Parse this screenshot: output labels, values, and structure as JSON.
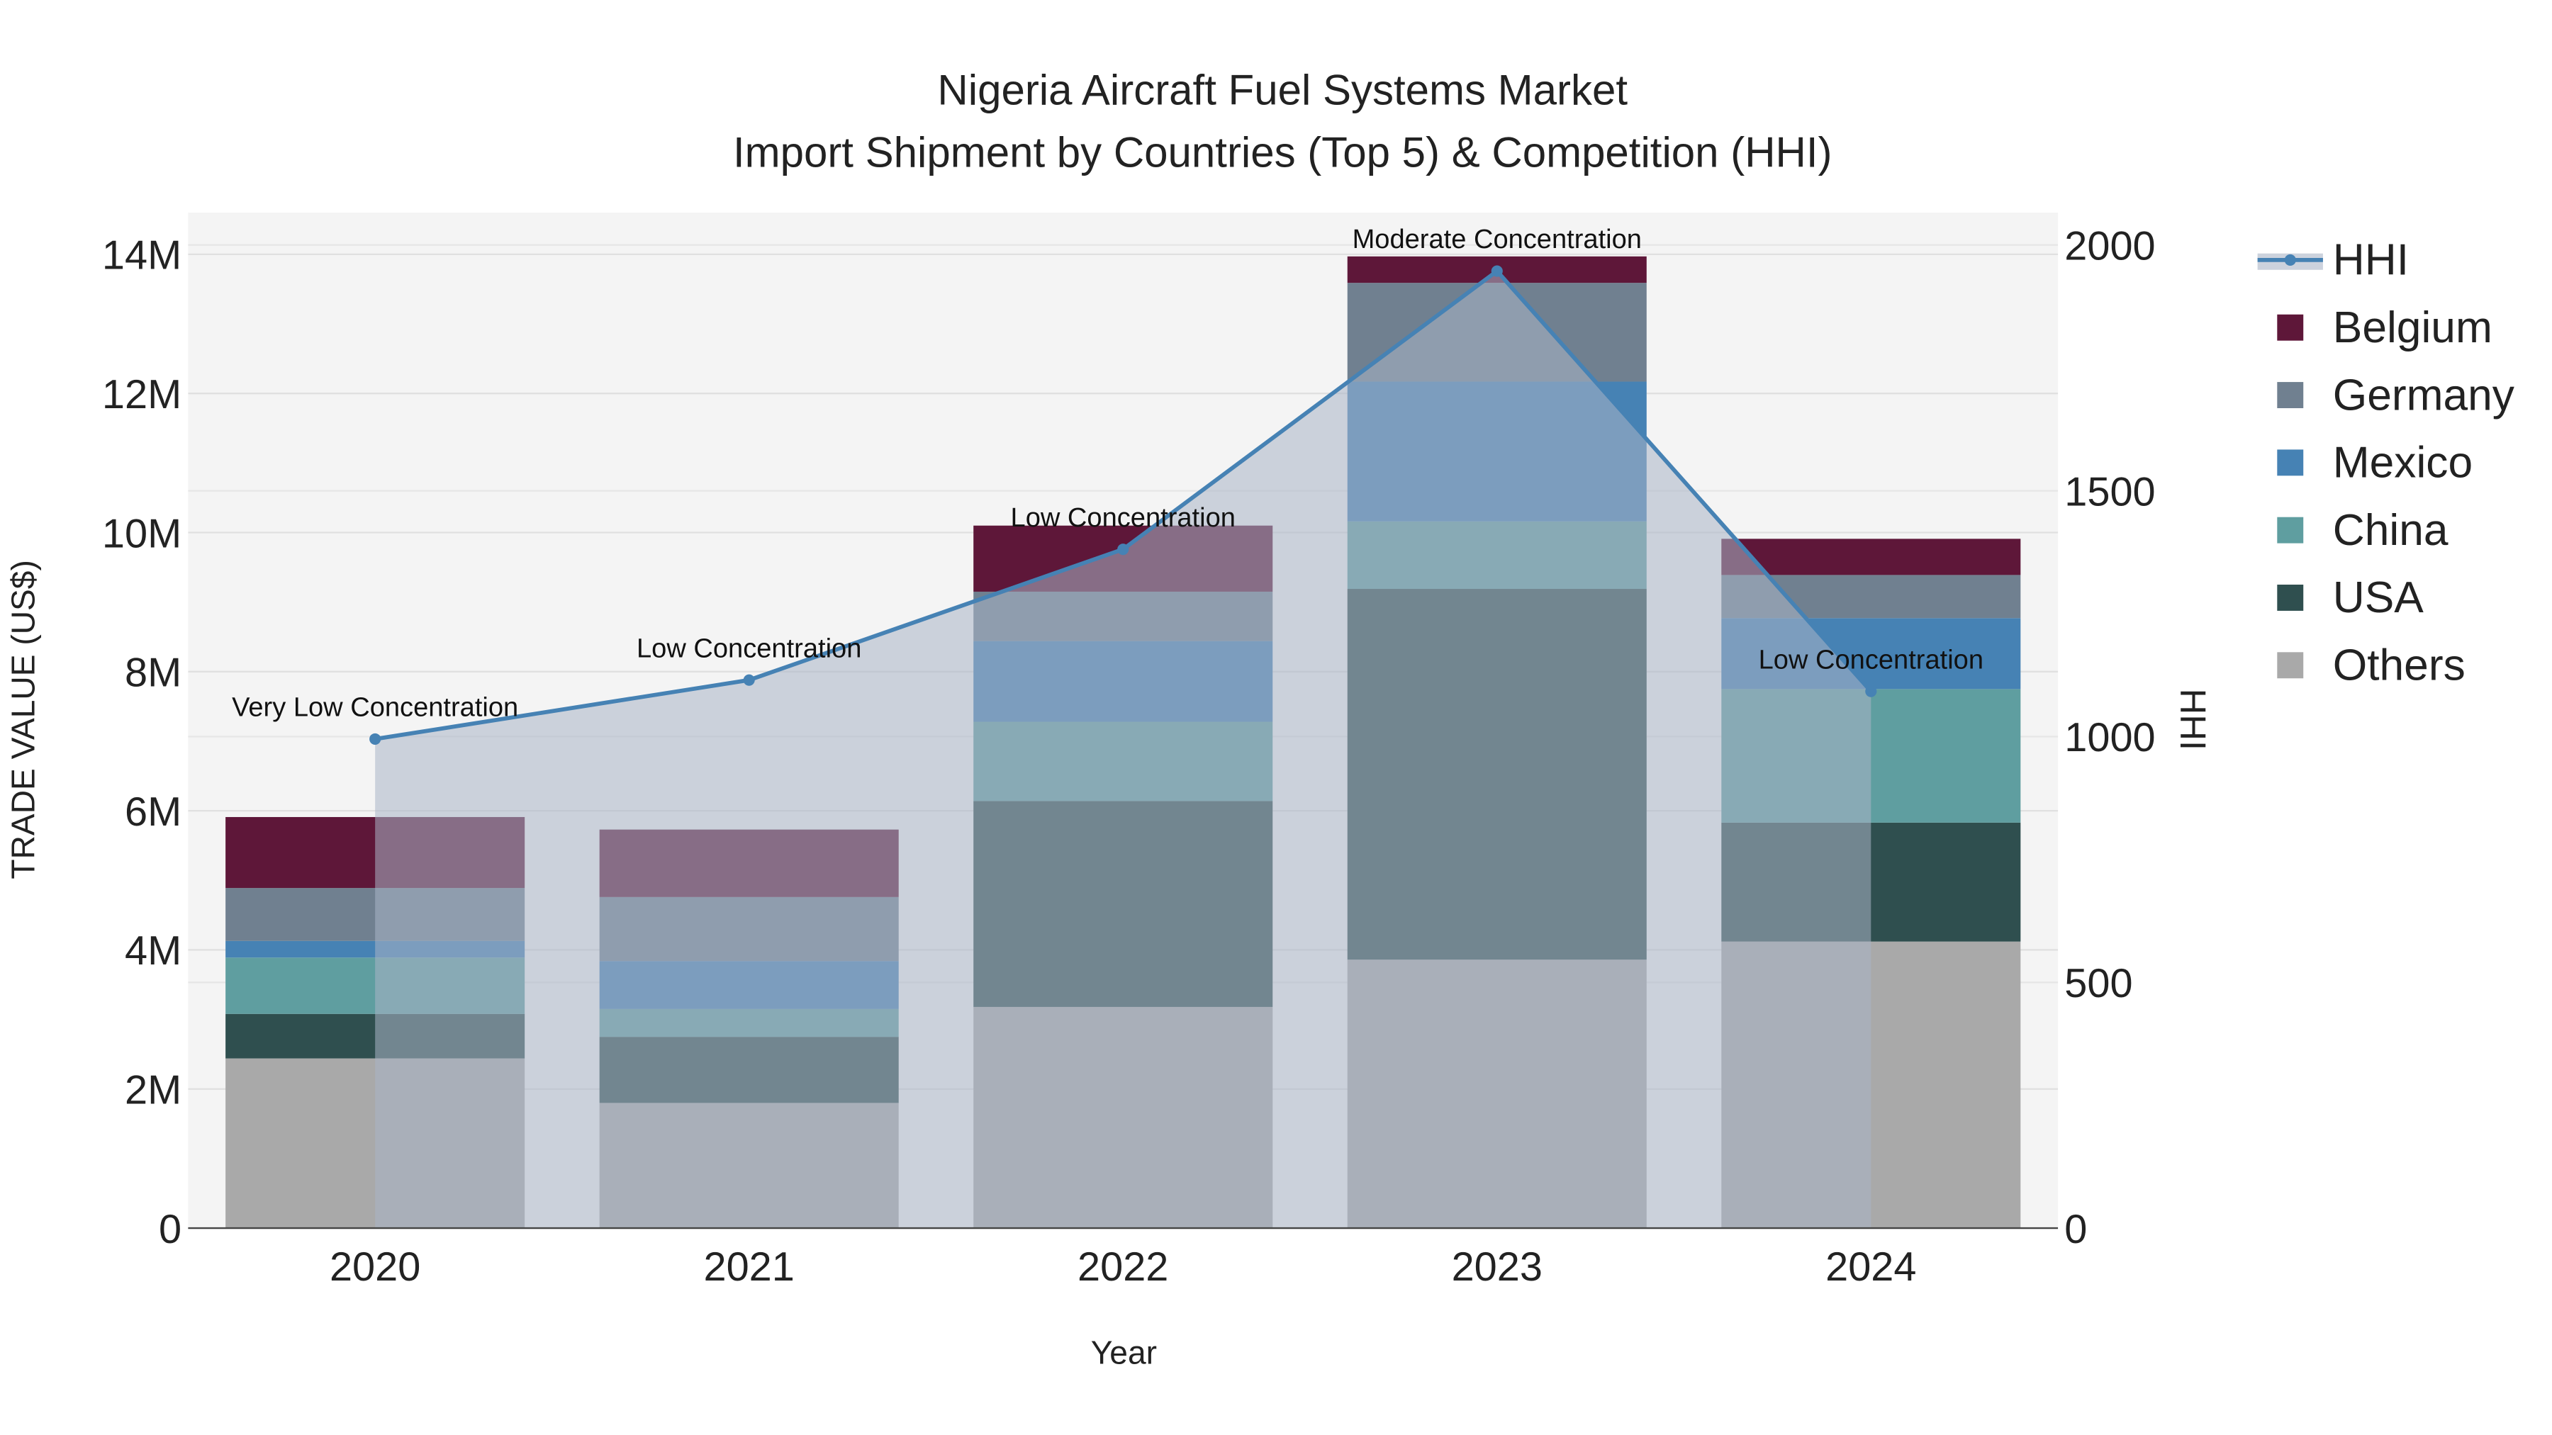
{
  "chart_data": {
    "type": "bar",
    "title": "Nigeria Aircraft Fuel Systems Market",
    "subtitle": "Import Shipment by Countries (Top 5) & Competition (HHI)",
    "xlabel": "Year",
    "ylabel": "TRADE VALUE (US$)",
    "y2label": "HHI",
    "categories": [
      "2020",
      "2021",
      "2022",
      "2023",
      "2024"
    ],
    "ylim": [
      0,
      14600000
    ],
    "y2lim": [
      0,
      2066
    ],
    "yticks": [
      0,
      2000000,
      4000000,
      6000000,
      8000000,
      10000000,
      12000000,
      14000000
    ],
    "ytick_labels": [
      "0",
      "2M",
      "4M",
      "6M",
      "8M",
      "10M",
      "12M",
      "14M"
    ],
    "y2ticks": [
      0,
      500,
      1000,
      1500,
      2000
    ],
    "y2tick_labels": [
      "0",
      "500",
      "1000",
      "1500",
      "2000"
    ],
    "series": [
      {
        "name": "Others",
        "color": "#a9a9a9",
        "values": [
          2440000,
          1800000,
          3180000,
          3860000,
          4120000
        ]
      },
      {
        "name": "USA",
        "color": "#2f4f4f",
        "values": [
          640000,
          950000,
          2960000,
          5330000,
          1710000
        ]
      },
      {
        "name": "China",
        "color": "#5f9ea0",
        "values": [
          810000,
          400000,
          1140000,
          970000,
          1920000
        ]
      },
      {
        "name": "Mexico",
        "color": "#4682b4",
        "values": [
          240000,
          690000,
          1160000,
          2010000,
          1020000
        ]
      },
      {
        "name": "Germany",
        "color": "#708090",
        "values": [
          760000,
          920000,
          710000,
          1420000,
          620000
        ]
      },
      {
        "name": "Belgium",
        "color": "#5e1739",
        "values": [
          1020000,
          970000,
          950000,
          380000,
          520000
        ]
      }
    ],
    "hhi": {
      "name": "HHI",
      "color": "#4682b4",
      "values": [
        995,
        1115,
        1381,
        1947,
        1092
      ],
      "annotations": [
        "Very Low Concentration",
        "Low Concentration",
        "Low Concentration",
        "Moderate Concentration",
        "Low Concentration"
      ]
    },
    "legend": [
      "HHI",
      "Belgium",
      "Germany",
      "Mexico",
      "China",
      "USA",
      "Others"
    ],
    "legend_position": "right",
    "grid": true
  }
}
